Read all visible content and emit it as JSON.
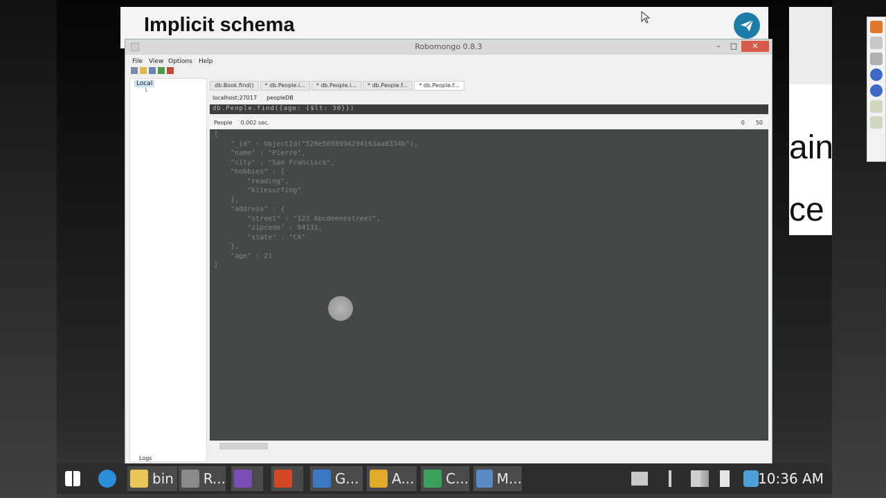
{
  "slide": {
    "title": "Implicit schema",
    "right_text_1": "ain",
    "right_text_2": "ce"
  },
  "app": {
    "title": "Robomongo 0.8.3",
    "menu": [
      "File",
      "View",
      "Options",
      "Help"
    ],
    "tree": {
      "root": "Local"
    },
    "tabs": [
      "db.Book.find()",
      "* db.People.i...",
      "* db.People.i...",
      "* db.People.f...",
      "* db.People.f..."
    ],
    "connection": {
      "host": "localhost:27017",
      "database": "peopleDB"
    },
    "query": "db.People.find({age: {$lt: 30}})",
    "result": {
      "collection": "People",
      "time": "0.002 sec.",
      "skip": "0",
      "limit": "50"
    },
    "document_lines": [
      "{",
      "    \"_id\" : ObjectId(\"528e5058994294163aa8334b\"),",
      "    \"name\" : \"Pierre\",",
      "    \"city\" : \"San Francisco\",",
      "    \"hobbies\" : [",
      "        \"reading\",",
      "        \"kitesurfing\"",
      "    ],",
      "    \"address\" : {",
      "        \"street\" : \"123 Abcdeeeestreet\",",
      "        \"zipcode\" : 94131,",
      "        \"state\" : \"CA\"",
      "    },",
      "    \"age\" : 21",
      "}"
    ],
    "logs_label": "Logs"
  },
  "taskbar": {
    "items": [
      {
        "label": "",
        "icon": "windows-start-icon",
        "color": "#ffffff"
      },
      {
        "label": "",
        "icon": "ie-icon",
        "color": "#2a8fd6"
      },
      {
        "label": "bin",
        "icon": "folder-icon",
        "color": "#e8c65a"
      },
      {
        "label": "R...",
        "icon": "robomongo-icon",
        "color": "#8a8a8a"
      },
      {
        "label": "",
        "icon": "visual-studio-icon",
        "color": "#7a4fb5"
      },
      {
        "label": "",
        "icon": "powerpoint-icon",
        "color": "#d24726"
      },
      {
        "label": "G...",
        "icon": "gephi-icon",
        "color": "#3a78c4"
      },
      {
        "label": "A...",
        "icon": "audacity-icon",
        "color": "#e3a92a"
      },
      {
        "label": "C...",
        "icon": "camtasia-icon",
        "color": "#3aa05a"
      },
      {
        "label": "M...",
        "icon": "mongo-icon",
        "color": "#5a8ac8"
      }
    ],
    "clock": "10:36 AM"
  },
  "colors": {
    "editor_bg": "#454849",
    "close_button": "#d75a4a",
    "logo_blue": "#1b7ca8"
  }
}
